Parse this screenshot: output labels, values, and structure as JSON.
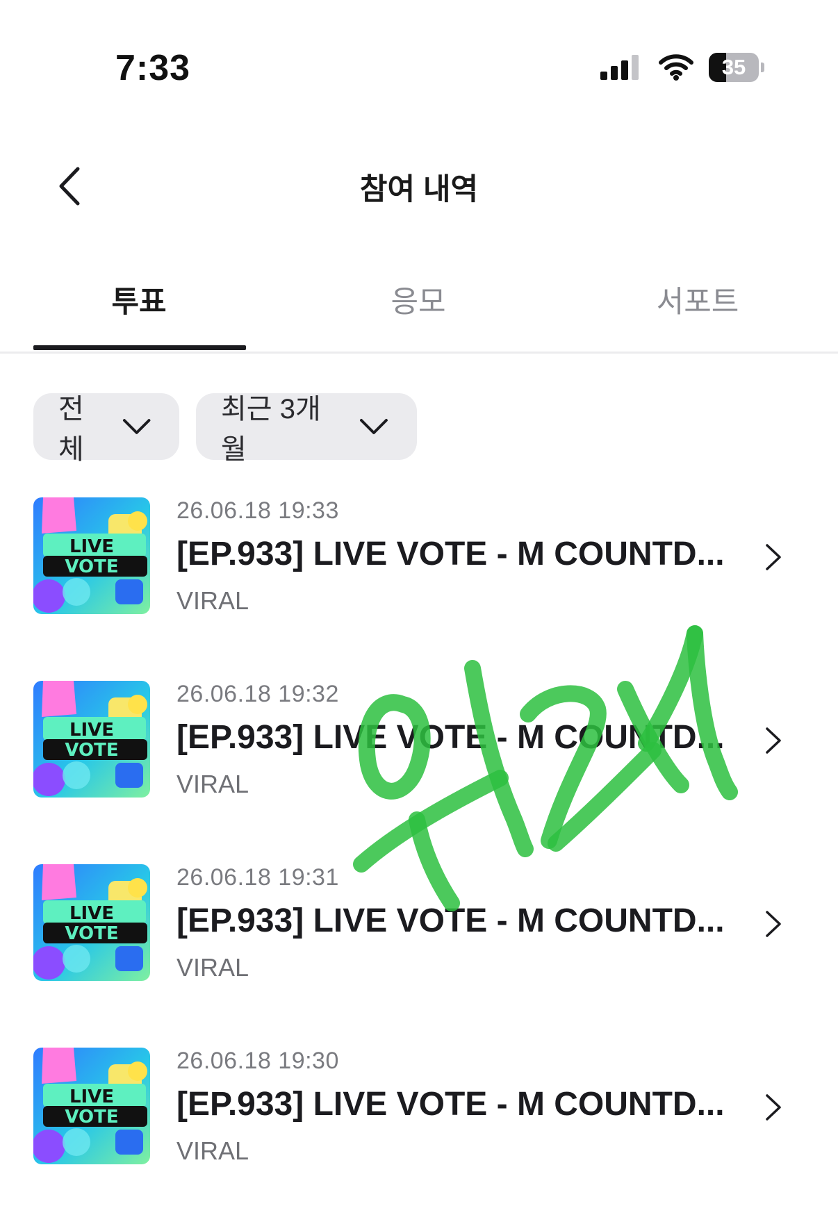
{
  "status_bar": {
    "time": "7:33",
    "battery_level": "35",
    "icons": [
      "signal-icon",
      "wifi-icon",
      "battery-icon"
    ]
  },
  "header": {
    "title": "참여 내역",
    "back_icon": "chevron-left-icon"
  },
  "tabs": [
    {
      "label": "투표",
      "active": true
    },
    {
      "label": "응모",
      "active": false
    },
    {
      "label": "서포트",
      "active": false
    }
  ],
  "filters": [
    {
      "label": "전체",
      "icon": "chevron-down-icon"
    },
    {
      "label": "최근 3개월",
      "icon": "chevron-down-icon"
    }
  ],
  "votes": [
    {
      "date": "26.06.18 19:33",
      "title": "[EP.933] LIVE VOTE - M COUNTD...",
      "artist": "VIRAL",
      "thumb_text": [
        "LIVE",
        "VOTE"
      ]
    },
    {
      "date": "26.06.18 19:32",
      "title": "[EP.933] LIVE VOTE - M COUNTD...",
      "artist": "VIRAL",
      "thumb_text": [
        "LIVE",
        "VOTE"
      ]
    },
    {
      "date": "26.06.18 19:31",
      "title": "[EP.933] LIVE VOTE - M COUNTD...",
      "artist": "VIRAL",
      "thumb_text": [
        "LIVE",
        "VOTE"
      ]
    },
    {
      "date": "26.06.18 19:30",
      "title": "[EP.933] LIVE VOTE - M COUNTD...",
      "artist": "VIRAL",
      "thumb_text": [
        "LIVE",
        "VOTE"
      ]
    }
  ],
  "colors": {
    "accent_text": "#1b1b1f",
    "muted_text": "#7a7b80",
    "chip_bg": "#ebebee",
    "scribble": "#2dbf3f"
  }
}
